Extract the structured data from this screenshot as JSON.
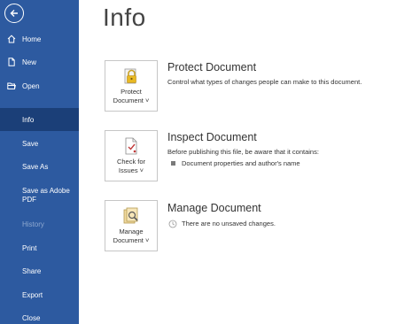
{
  "sidebar": {
    "back_label": "Back",
    "items": [
      {
        "label": "Home",
        "icon": "home-icon"
      },
      {
        "label": "New",
        "icon": "new-document-icon"
      },
      {
        "label": "Open",
        "icon": "open-folder-icon"
      },
      {
        "label": "Info",
        "selected": true
      },
      {
        "label": "Save"
      },
      {
        "label": "Save As"
      },
      {
        "label": "Save as Adobe",
        "label2": "PDF"
      },
      {
        "label": "History",
        "disabled": true
      },
      {
        "label": "Print"
      },
      {
        "label": "Share"
      },
      {
        "label": "Export"
      },
      {
        "label": "Close"
      }
    ],
    "colors": {
      "background": "#2d5aa0",
      "selected": "#1b3f78"
    }
  },
  "main": {
    "title": "Info",
    "sections": [
      {
        "tile_line1": "Protect",
        "tile_line2": "Document ˅",
        "tile_icon": "lock-icon",
        "heading": "Protect Document",
        "description": "Control what types of changes people can make to this document."
      },
      {
        "tile_line1": "Check for",
        "tile_line2": "Issues ˅",
        "tile_icon": "check-document-icon",
        "heading": "Inspect Document",
        "description": "Before publishing this file, be aware that it contains:",
        "bullets": [
          "Document properties and author's name"
        ]
      },
      {
        "tile_line1": "Manage",
        "tile_line2": "Document ˅",
        "tile_icon": "manage-document-icon",
        "heading": "Manage Document",
        "sub": "There are no unsaved changes."
      }
    ]
  }
}
